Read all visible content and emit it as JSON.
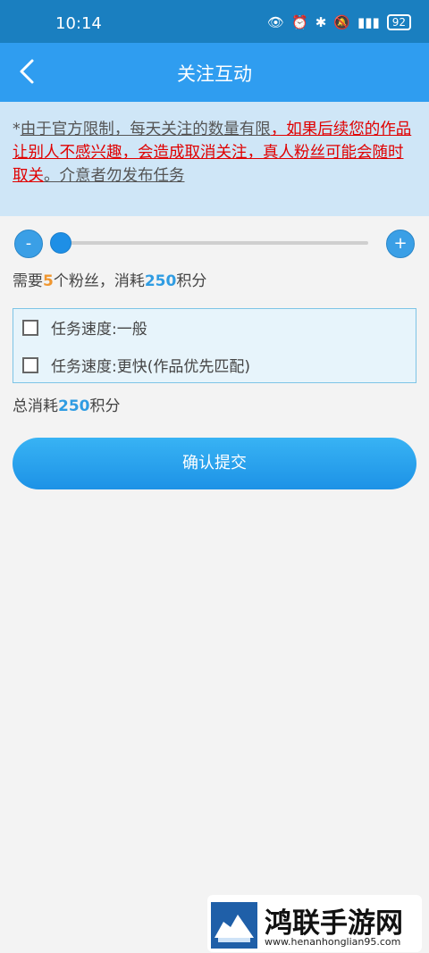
{
  "status": {
    "time": "10:14",
    "battery": "92"
  },
  "header": {
    "title": "关注互动"
  },
  "notice": {
    "prefix": "*",
    "part1": "由于官方限制，每天关注的数量有限",
    "part2": "，如果后续您的作品让别人不感兴趣，会造成取消关注，真人粉丝可能会随时取关",
    "part3": "。介意者勿发布任务"
  },
  "slider": {
    "minus": "-",
    "plus": "+",
    "value_fraction": 0.0
  },
  "need": {
    "before": "需要",
    "count": "5",
    "middle": "个粉丝，消耗",
    "points": "250",
    "after": "积分"
  },
  "options": [
    {
      "label": "任务速度:一般",
      "checked": false
    },
    {
      "label": "任务速度:更快(作品优先匹配)",
      "checked": false
    }
  ],
  "total": {
    "before": "总消耗",
    "points": "250",
    "after": "积分"
  },
  "submit_label": "确认提交",
  "watermark": {
    "title": "鸿联手游网",
    "url": "www.henanhonglian95.com"
  },
  "colors": {
    "appbar": "#2f9df0",
    "statusbar": "#1a7fc0",
    "accent_orange": "#f0962e",
    "accent_blue": "#2f9ce2",
    "notice_bg": "#cfe6f7"
  }
}
